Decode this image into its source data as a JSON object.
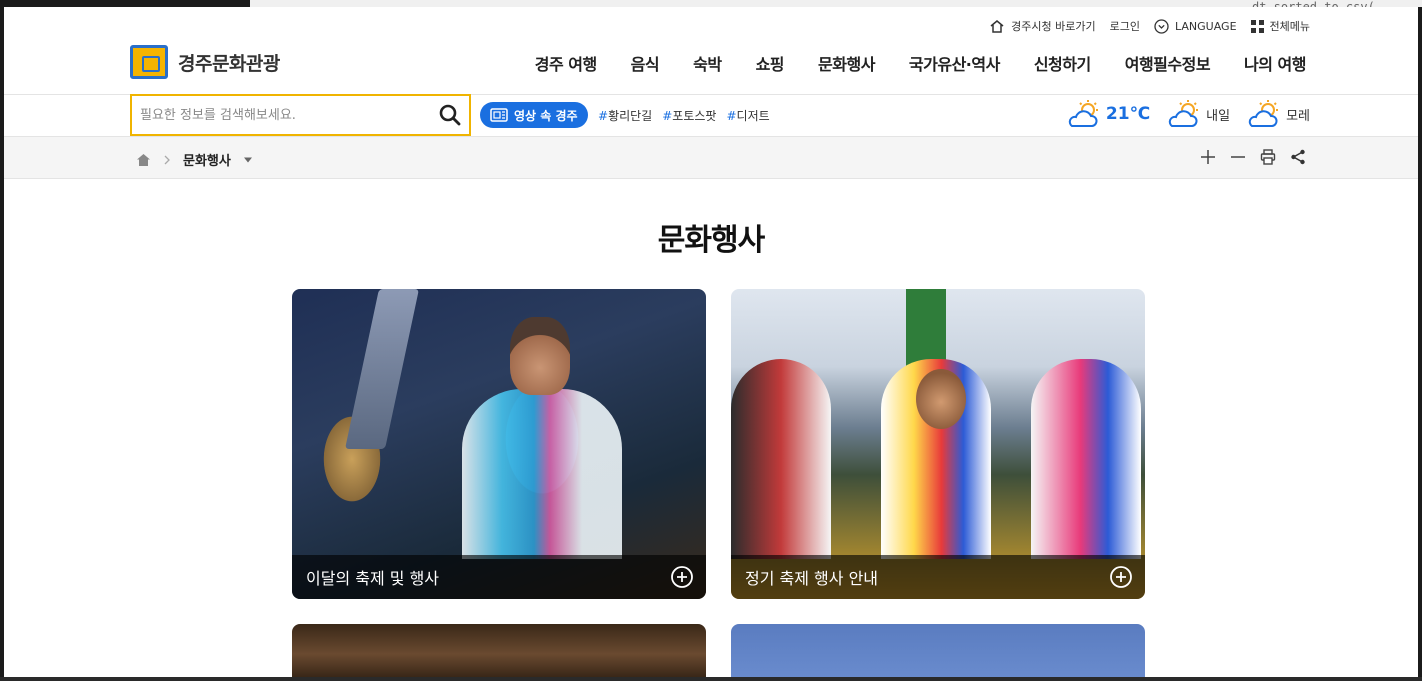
{
  "background": {
    "edge_text": "dt_sorted_to_csv("
  },
  "utility": {
    "city_hall": "경주시청 바로가기",
    "login": "로그인",
    "language": "LANGUAGE",
    "all_menu": "전체메뉴"
  },
  "header": {
    "logo_text": "경주문화관광",
    "nav": [
      "경주 여행",
      "음식",
      "숙박",
      "쇼핑",
      "문화행사",
      "국가유산·역사",
      "신청하기",
      "여행필수정보",
      "나의 여행"
    ]
  },
  "search": {
    "placeholder": "필요한 정보를 검색해보세요.",
    "video_button": "영상 속 경주",
    "tags": [
      "황리단길",
      "포토스팟",
      "디저트"
    ]
  },
  "weather": {
    "today_temp": "21℃",
    "tomorrow": "내일",
    "day_after": "모레",
    "accent": "#1a6fe0",
    "sun_color": "#f5a623"
  },
  "breadcrumb": {
    "current": "문화행사"
  },
  "page": {
    "title": "문화행사"
  },
  "cards": [
    {
      "label": "이달의 축제 및 행사"
    },
    {
      "label": "정기 축제 행사 안내"
    }
  ],
  "colors": {
    "brand_yellow": "#f0b400",
    "brand_blue": "#1a6fe0"
  }
}
